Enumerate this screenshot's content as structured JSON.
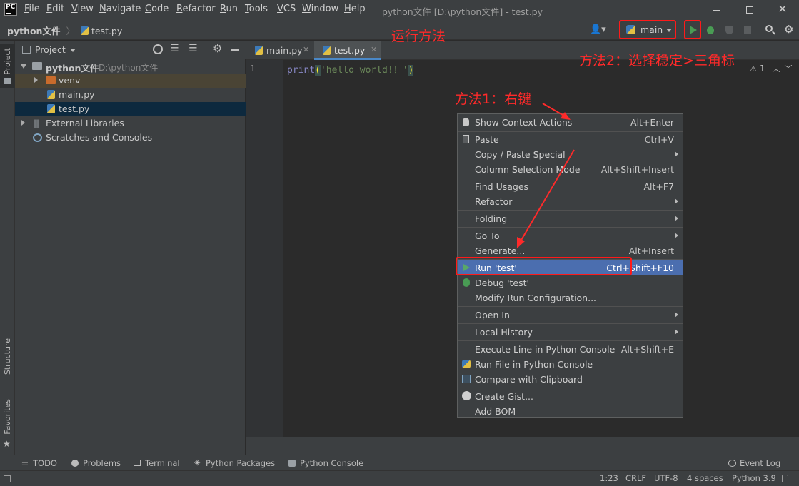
{
  "window": {
    "title": "python文件 [D:\\python文件] - test.py",
    "menu": [
      "File",
      "Edit",
      "View",
      "Navigate",
      "Code",
      "Refactor",
      "Run",
      "Tools",
      "VCS",
      "Window",
      "Help"
    ],
    "app_icon_text": "PC"
  },
  "breadcrumb": {
    "project": "python文件",
    "file": "test.py"
  },
  "run_config": {
    "label": "main"
  },
  "left_strip": {
    "project": "Project",
    "structure": "Structure",
    "favorites": "Favorites"
  },
  "project_panel": {
    "header": "Project",
    "tree": [
      {
        "label": "python文件",
        "path": "D:\\python文件"
      },
      {
        "label": "venv"
      },
      {
        "label": "main.py"
      },
      {
        "label": "test.py"
      },
      {
        "label": "External Libraries"
      },
      {
        "label": "Scratches and Consoles"
      }
    ]
  },
  "editor": {
    "tabs": [
      {
        "label": "main.py"
      },
      {
        "label": "test.py"
      }
    ],
    "line_number": "1",
    "code": {
      "fn": "print",
      "open": "(",
      "str": "'hello world!！'",
      "close": ")"
    },
    "inspection_count": "1"
  },
  "context_menu": {
    "items": [
      {
        "label": "Show Context Actions",
        "shortcut": "Alt+Enter"
      },
      {
        "label": "Paste",
        "shortcut": "Ctrl+V"
      },
      {
        "label": "Copy / Paste Special",
        "shortcut": ""
      },
      {
        "label": "Column Selection Mode",
        "shortcut": "Alt+Shift+Insert"
      },
      {
        "label": "Find Usages",
        "shortcut": "Alt+F7"
      },
      {
        "label": "Refactor",
        "shortcut": ""
      },
      {
        "label": "Folding",
        "shortcut": ""
      },
      {
        "label": "Go To",
        "shortcut": ""
      },
      {
        "label": "Generate...",
        "shortcut": "Alt+Insert"
      },
      {
        "label": "Run 'test'",
        "shortcut": "Ctrl+Shift+F10"
      },
      {
        "label": "Debug 'test'",
        "shortcut": ""
      },
      {
        "label": "Modify Run Configuration...",
        "shortcut": ""
      },
      {
        "label": "Open In",
        "shortcut": ""
      },
      {
        "label": "Local History",
        "shortcut": ""
      },
      {
        "label": "Execute Line in Python Console",
        "shortcut": "Alt+Shift+E"
      },
      {
        "label": "Run File in Python Console",
        "shortcut": ""
      },
      {
        "label": "Compare with Clipboard",
        "shortcut": ""
      },
      {
        "label": "Create Gist...",
        "shortcut": ""
      },
      {
        "label": "Add BOM",
        "shortcut": ""
      }
    ]
  },
  "tool_windows": [
    "TODO",
    "Problems",
    "Terminal",
    "Python Packages",
    "Python Console",
    "Event Log"
  ],
  "status": {
    "position": "1:23",
    "line_sep": "CRLF",
    "encoding": "UTF-8",
    "indent": "4 spaces",
    "interpreter": "Python 3.9"
  },
  "annotations": {
    "run_method": "运行方法",
    "method2": "方法2：选择稳定>三角标",
    "method1": "方法1：右键"
  },
  "colors": {
    "accent": "#4b6eaf",
    "annotation_red": "#ff2a2a",
    "run_green": "#499c54"
  }
}
